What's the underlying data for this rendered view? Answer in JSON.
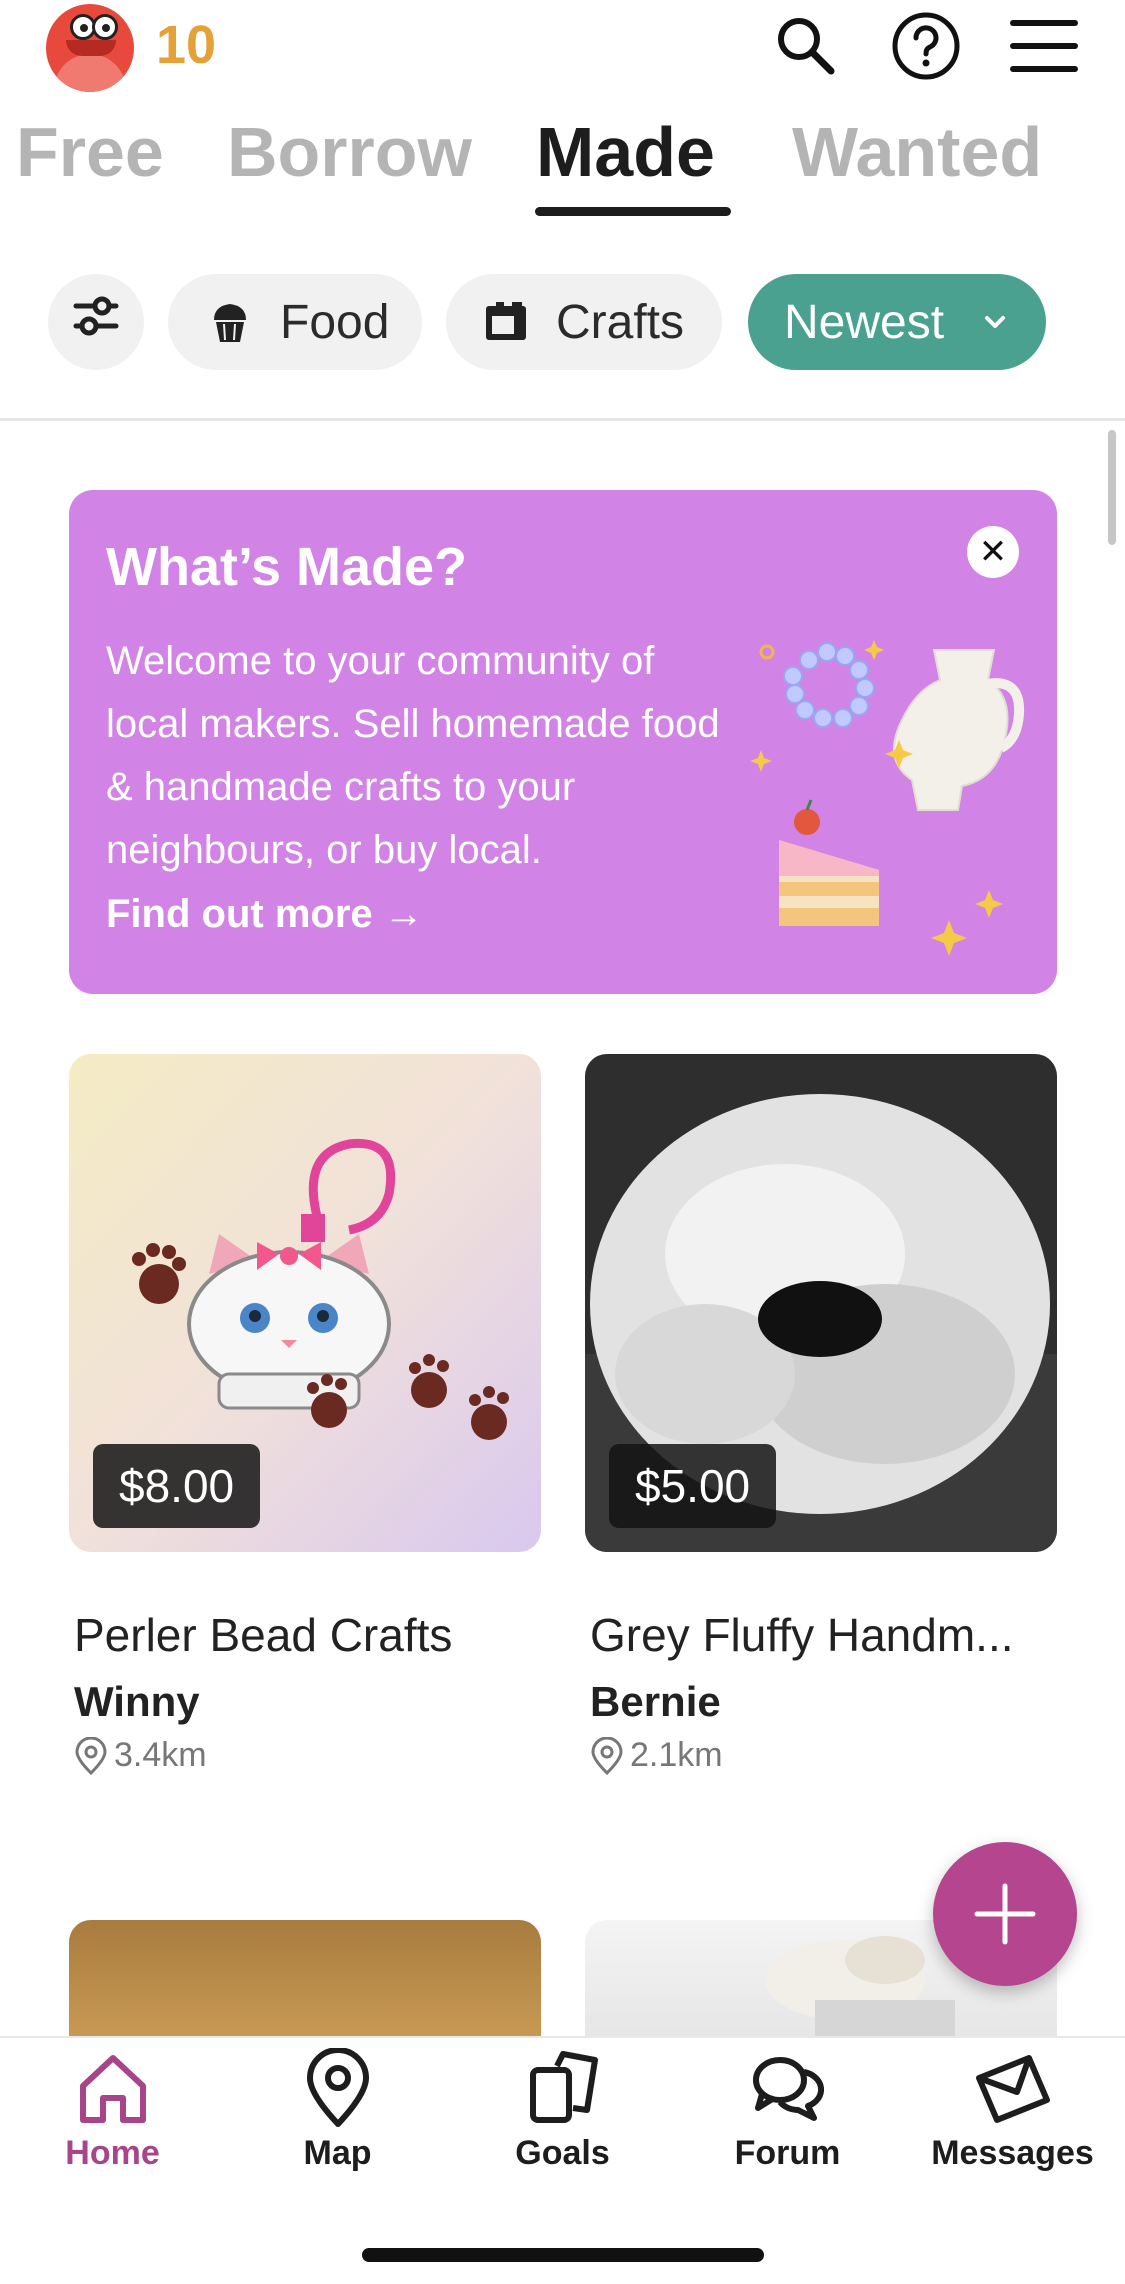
{
  "header": {
    "points": "10",
    "icons": [
      "search-icon",
      "help-icon",
      "menu-icon"
    ]
  },
  "tabs": [
    {
      "label": "Free",
      "active": false
    },
    {
      "label": "Borrow",
      "active": false
    },
    {
      "label": "Made",
      "active": true
    },
    {
      "label": "Wanted",
      "active": false
    }
  ],
  "filters": {
    "food_label": "Food",
    "crafts_label": "Crafts",
    "sort_label": "Newest"
  },
  "banner": {
    "title": "What’s Made?",
    "body": "Welcome to your community of local makers. Sell homemade food & handmade crafts to your neighbours, or buy local.",
    "link": "Find out more →"
  },
  "listings": [
    {
      "title": "Perler Bead Crafts",
      "seller": "Winny",
      "distance": "3.4km",
      "price": "$8.00"
    },
    {
      "title": "Grey Fluffy Handm...",
      "seller": "Bernie",
      "distance": "2.1km",
      "price": "$5.00"
    }
  ],
  "bottom_nav": [
    {
      "label": "Home",
      "icon": "home-icon",
      "active": true
    },
    {
      "label": "Map",
      "icon": "map-pin-icon",
      "active": false
    },
    {
      "label": "Goals",
      "icon": "goals-icon",
      "active": false
    },
    {
      "label": "Forum",
      "icon": "forum-icon",
      "active": false
    },
    {
      "label": "Messages",
      "icon": "messages-icon",
      "active": false
    }
  ],
  "colors": {
    "accent_teal": "#4aa18f",
    "banner_purple": "#d183e6",
    "brand_magenta": "#b5458e",
    "points_gold": "#e4a137"
  }
}
